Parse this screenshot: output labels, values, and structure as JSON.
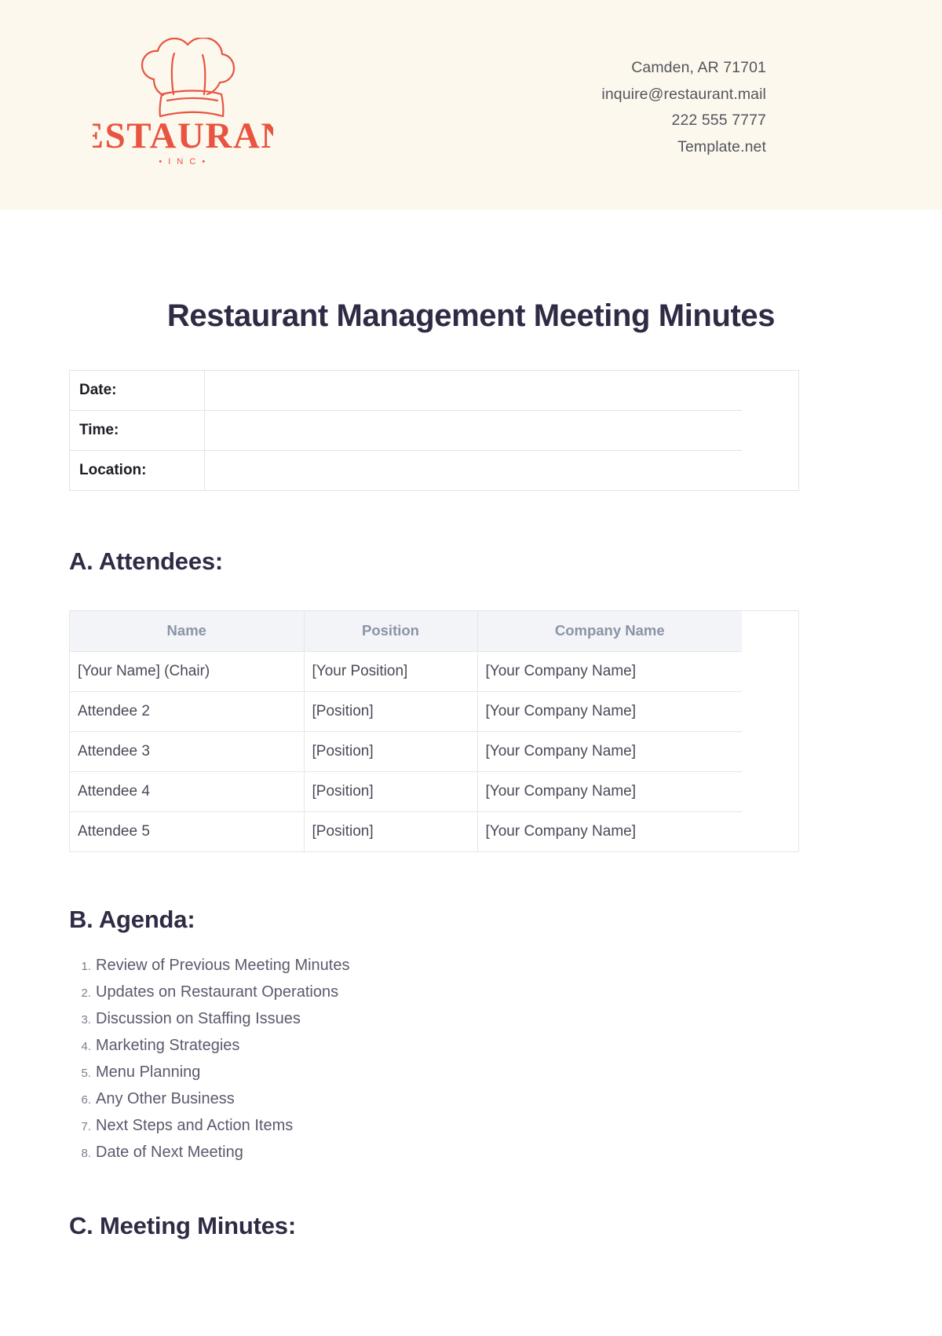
{
  "header": {
    "logo": {
      "brand_name": "RESTAURANT",
      "brand_suffix": "• I N C •",
      "icon_name": "chef-hat-icon",
      "color": "#e8543f"
    },
    "contact": [
      "Camden, AR 71701",
      "inquire@restaurant.mail",
      "222 555 7777",
      "Template.net"
    ],
    "background_color": "#fdf8ee"
  },
  "document": {
    "title": "Restaurant Management Meeting Minutes",
    "meta_rows": [
      {
        "label": "Date:",
        "value": ""
      },
      {
        "label": "Time:",
        "value": ""
      },
      {
        "label": "Location:",
        "value": ""
      }
    ],
    "sections": {
      "attendees": {
        "heading": "A. Attendees:",
        "columns": [
          "Name",
          "Position",
          "Company Name"
        ],
        "rows": [
          [
            "[Your Name] (Chair)",
            "[Your Position]",
            "[Your Company Name]"
          ],
          [
            "Attendee 2",
            "[Position]",
            "[Your Company Name]"
          ],
          [
            "Attendee 3",
            "[Position]",
            "[Your Company Name]"
          ],
          [
            "Attendee 4",
            "[Position]",
            "[Your Company Name]"
          ],
          [
            "Attendee 5",
            "[Position]",
            "[Your Company Name]"
          ]
        ]
      },
      "agenda": {
        "heading": "B. Agenda:",
        "items": [
          {
            "num": "1.",
            "text": "Review of Previous Meeting Minutes"
          },
          {
            "num": "2.",
            "text": "Updates on Restaurant Operations"
          },
          {
            "num": "3.",
            "text": "Discussion on Staffing Issues"
          },
          {
            "num": "4.",
            "text": "Marketing Strategies"
          },
          {
            "num": "5.",
            "text": "Menu Planning"
          },
          {
            "num": "6.",
            "text": "Any Other Business"
          },
          {
            "num": "7.",
            "text": "Next Steps and Action Items"
          },
          {
            "num": "8.",
            "text": "Date of Next Meeting"
          }
        ]
      },
      "minutes": {
        "heading": "C. Meeting Minutes:"
      }
    }
  },
  "colors": {
    "heading": "#2f2b45",
    "body_text": "#5a5a6d",
    "table_header_bg": "#f3f4f8",
    "table_header_text": "#8a94a6",
    "border": "#e6e6ea",
    "brand": "#e8543f",
    "header_bg": "#fdf8ee"
  }
}
